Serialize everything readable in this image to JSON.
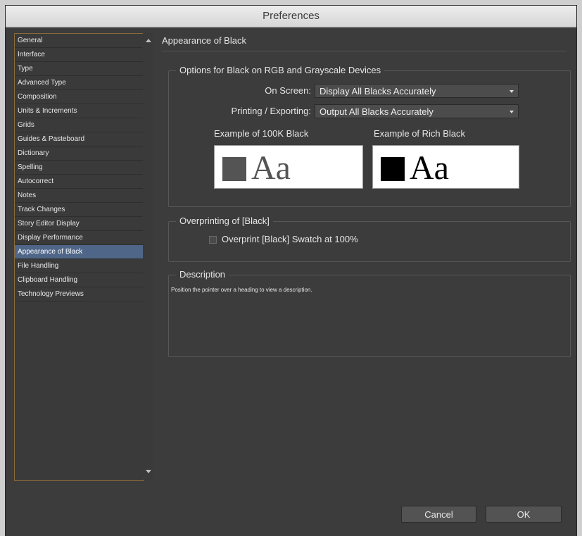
{
  "window": {
    "title": "Preferences"
  },
  "sidebar": {
    "items": [
      {
        "label": "General",
        "selected": false
      },
      {
        "label": "Interface",
        "selected": false
      },
      {
        "label": "Type",
        "selected": false
      },
      {
        "label": "Advanced Type",
        "selected": false
      },
      {
        "label": "Composition",
        "selected": false
      },
      {
        "label": "Units & Increments",
        "selected": false
      },
      {
        "label": "Grids",
        "selected": false
      },
      {
        "label": "Guides & Pasteboard",
        "selected": false
      },
      {
        "label": "Dictionary",
        "selected": false
      },
      {
        "label": "Spelling",
        "selected": false
      },
      {
        "label": "Autocorrect",
        "selected": false
      },
      {
        "label": "Notes",
        "selected": false
      },
      {
        "label": "Track Changes",
        "selected": false
      },
      {
        "label": "Story Editor Display",
        "selected": false
      },
      {
        "label": "Display Performance",
        "selected": false
      },
      {
        "label": "Appearance of Black",
        "selected": true
      },
      {
        "label": "File Handling",
        "selected": false
      },
      {
        "label": "Clipboard Handling",
        "selected": false
      },
      {
        "label": "Technology Previews",
        "selected": false
      }
    ]
  },
  "main": {
    "title": "Appearance of Black",
    "options_group": {
      "legend": "Options for Black on RGB and Grayscale Devices",
      "on_screen_label": "On Screen:",
      "on_screen_value": "Display All Blacks Accurately",
      "printing_label": "Printing / Exporting:",
      "printing_value": "Output All Blacks Accurately",
      "example_100k_label": "Example of 100K Black",
      "example_100k_text": "Aa",
      "example_100k_color": "#545454",
      "example_rich_label": "Example of Rich Black",
      "example_rich_text": "Aa",
      "example_rich_color": "#000000"
    },
    "overprint_group": {
      "legend": "Overprinting of [Black]",
      "checkbox_label": "Overprint [Black] Swatch at 100%",
      "checked": false
    },
    "description_group": {
      "legend": "Description",
      "text": "Position the pointer over a heading to view a description."
    }
  },
  "buttons": {
    "cancel": "Cancel",
    "ok": "OK"
  },
  "colors": {
    "selection": "#4f6689",
    "sidebar_border": "#8a6a3a",
    "dialog_bg": "#3c3c3c"
  }
}
